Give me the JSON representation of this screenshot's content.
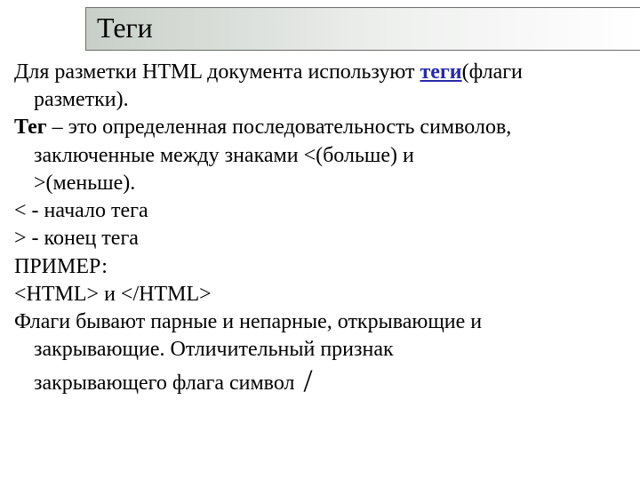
{
  "title": "Теги",
  "p1_a": "Для разметки HTML документа используют ",
  "p1_link": "теги",
  "p1_b": "(флаги",
  "p1_c": "разметки).",
  "p2_a": "Тег",
  "p2_b": " – это определенная последовательность символов,",
  "p2_c": "заключенные между знаками <(больше)  и",
  "p2_d": ">(меньше).",
  "p3": "< - начало тега",
  "p4": "> - конец тега",
  "p5": "ПРИМЕР:",
  "p6": "<HTML> и </HTML>",
  "p7_a": "Флаги бывают парные и непарные, открывающие и",
  "p7_b": "закрывающие. Отличительный признак",
  "p7_c": "закрывающего флага символ ",
  "slash": "/"
}
